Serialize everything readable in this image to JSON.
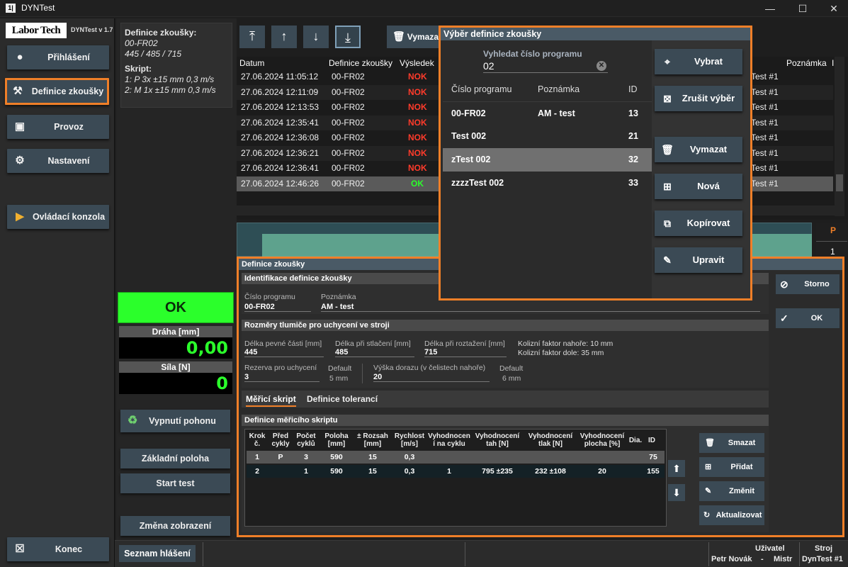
{
  "window": {
    "title": "DYNTest",
    "minimize": "—",
    "maximize": "☐",
    "close": "✕"
  },
  "sidebar": {
    "logo": "Labor Tech",
    "version": "DYNTest v 1.7",
    "items": [
      {
        "label": "Přihlášení",
        "icon": "user-icon"
      },
      {
        "label": "Definice zkoušky",
        "icon": "hammer-icon"
      },
      {
        "label": "Provoz",
        "icon": "car-icon"
      },
      {
        "label": "Nastavení",
        "icon": "gear-icon"
      },
      {
        "label": "Ovládací konzola",
        "icon": "console-icon"
      }
    ],
    "exit_label": "Konec"
  },
  "info": {
    "def_label": "Definice zkoušky:",
    "def_name": "00-FR02",
    "def_dims": "445 / 485 / 715",
    "script_label": "Skript:",
    "script_line1": "1: P  3x  ±15 mm  0,3 m/s",
    "script_line2": "2: M  1x  ±15 mm  0,3 m/s",
    "status": "OK",
    "draha_label": "Dráha [mm]",
    "draha_value": "0,00",
    "sila_label": "Síla [N]",
    "sila_value": "0",
    "btn_vypnuti": "Vypnutí pohonu",
    "btn_zakladni": "Základní poloha",
    "btn_start": "Start test",
    "btn_zmena": "Změna zobrazení"
  },
  "toolbar": {
    "delete_label": "Vymaza"
  },
  "results": {
    "headers": {
      "datum": "Datum",
      "definice": "Definice zkoušky",
      "vysledek": "Výsledek",
      "poznamka": "Poznámka",
      "extra": "I"
    },
    "rows": [
      {
        "datum": "27.06.2024 11:05:12",
        "def": "00-FR02",
        "res": "NOK",
        "note": "Test #1"
      },
      {
        "datum": "27.06.2024 12:11:09",
        "def": "00-FR02",
        "res": "NOK",
        "note": "Test #1"
      },
      {
        "datum": "27.06.2024 12:13:53",
        "def": "00-FR02",
        "res": "NOK",
        "note": "Test #1"
      },
      {
        "datum": "27.06.2024 12:35:41",
        "def": "00-FR02",
        "res": "NOK",
        "note": "Test #1"
      },
      {
        "datum": "27.06.2024 12:36:08",
        "def": "00-FR02",
        "res": "NOK",
        "note": "Test #1"
      },
      {
        "datum": "27.06.2024 12:36:21",
        "def": "00-FR02",
        "res": "NOK",
        "note": "Test #1"
      },
      {
        "datum": "27.06.2024 12:36:41",
        "def": "00-FR02",
        "res": "NOK",
        "note": "Test #1"
      },
      {
        "datum": "27.06.2024 12:46:26",
        "def": "00-FR02",
        "res": "OK",
        "note": "Test #1"
      }
    ],
    "p_header": "P",
    "p_value": "1"
  },
  "definition": {
    "title": "Definice zkoušky",
    "ident_title": "Identifikace definice zkoušky",
    "cislo_label": "Číslo programu",
    "cislo_value": "00-FR02",
    "poznamka_label": "Poznámka",
    "poznamka_value": "AM - test",
    "rozmery_title": "Rozměry tlumiče pro uchycení ve stroji",
    "pevne_label": "Délka pevné části [mm]",
    "pevne_value": "445",
    "stlaceni_label": "Délka při stlačení [mm]",
    "stlaceni_value": "485",
    "roztazeni_label": "Délka při roztažení [mm]",
    "roztazeni_value": "715",
    "kolizni_nahore": "Kolizní faktor nahoře:  10 mm",
    "kolizni_dole": "Kolizní faktor dole:  35 mm",
    "rezerva_label": "Rezerva pro uchycení",
    "rezerva_value": "3",
    "rezerva_default_label": "Default",
    "rezerva_default_value": "5 mm",
    "vyska_label": "Výška dorazu (v čelistech nahoře)",
    "vyska_value": "20",
    "vyska_default_label": "Default",
    "vyska_default_value": "6 mm",
    "tab_script": "Měřicí skript",
    "tab_tol": "Definice tolerancí",
    "script_title": "Definice měřicího skriptu",
    "storno": "Storno",
    "ok": "OK",
    "btn_smazat": "Smazat",
    "btn_pridat": "Přidat",
    "btn_zmenit": "Změnit",
    "btn_aktualizovat": "Aktualizovat",
    "script_headers": [
      "Krok č.",
      "Před cykly",
      "Počet cyklů",
      "Poloha [mm]",
      "± Rozsah [mm]",
      "Rychlost [m/s]",
      "Vyhodnocen í na cyklu",
      "Vyhodnocení tah [N]",
      "Vyhodnocení tlak [N]",
      "Vyhodnocení plocha [%]",
      "Dia.",
      "ID"
    ],
    "script_rows": [
      [
        "1",
        "P",
        "3",
        "590",
        "15",
        "0,3",
        "",
        "",
        "",
        "",
        "",
        "75"
      ],
      [
        "2",
        "",
        "1",
        "590",
        "15",
        "0,3",
        "1",
        "795  ±235",
        "232  ±108",
        "20",
        "",
        "155"
      ]
    ]
  },
  "modal": {
    "title": "Výběr definice zkoušky",
    "search_label": "Vyhledat číslo programu",
    "search_value": "02",
    "col_cislo": "Číslo programu",
    "col_poznamka": "Poznámka",
    "col_id": "ID",
    "rows": [
      {
        "cislo": "00-FR02",
        "note": "AM - test",
        "id": "13"
      },
      {
        "cislo": "Test 002",
        "note": "",
        "id": "21"
      },
      {
        "cislo": "zTest 002",
        "note": "",
        "id": "32"
      },
      {
        "cislo": "zzzzTest 002",
        "note": "",
        "id": "33"
      }
    ],
    "btn_vybrat": "Vybrat",
    "btn_zrusit": "Zrušit výběr",
    "btn_vymazat": "Vymazat",
    "btn_nova": "Nová",
    "btn_kopirovat": "Kopírovat",
    "btn_upravit": "Upravit"
  },
  "statusbar": {
    "seznam": "Seznam hlášení",
    "user_label": "Uživatel",
    "user_name": "Petr Novák",
    "user_sep": "-",
    "user_role": "Mistr",
    "machine_label": "Stroj",
    "machine_name": "DynTest #1"
  },
  "colors": {
    "accent": "#f07f28",
    "ok": "#2bff2b",
    "nok": "#ff3b2b",
    "button": "#3b4a55"
  }
}
